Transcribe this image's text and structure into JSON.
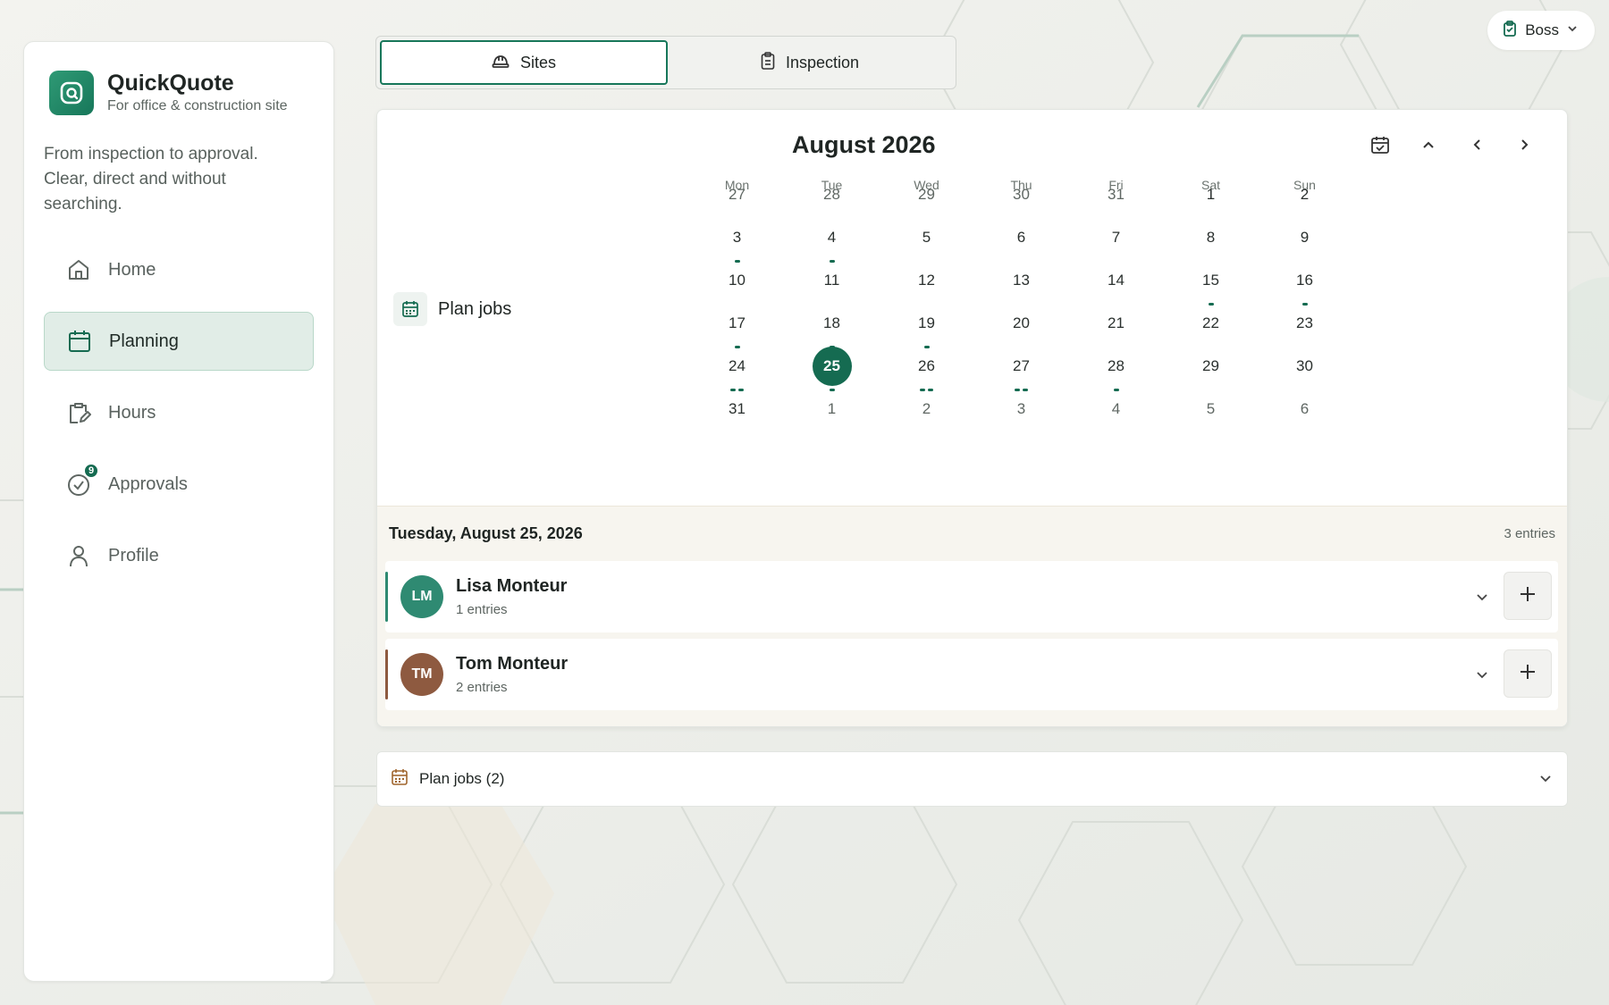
{
  "app": {
    "name": "QuickQuote",
    "subtitle": "For office & construction site",
    "tagline": "From inspection to approval. Clear, direct and without searching.",
    "accent": "#156b51"
  },
  "nav": [
    {
      "label": "Home",
      "icon": "home-icon",
      "active": false
    },
    {
      "label": "Planning",
      "icon": "calendar-icon",
      "active": true
    },
    {
      "label": "Hours",
      "icon": "clipboard-edit-icon",
      "active": false
    },
    {
      "label": "Approvals",
      "icon": "check-circle-icon",
      "active": false,
      "badge": "9"
    },
    {
      "label": "Profile",
      "icon": "user-icon",
      "active": false
    }
  ],
  "user": {
    "label": "Boss"
  },
  "tabs": [
    {
      "label": "Sites",
      "icon": "hard-hat-icon",
      "active": true
    },
    {
      "label": "Inspection",
      "icon": "clipboard-icon",
      "active": false
    }
  ],
  "calendar": {
    "plan_label": "Plan jobs",
    "month_title": "August 2026",
    "weekdays": [
      "Mon",
      "Tue",
      "Wed",
      "Thu",
      "Fri",
      "Sat",
      "Sun"
    ],
    "weeks": [
      [
        {
          "d": "27",
          "m": true
        },
        {
          "d": "28",
          "m": true
        },
        {
          "d": "29",
          "m": true
        },
        {
          "d": "30",
          "m": true
        },
        {
          "d": "31",
          "m": true
        },
        {
          "d": "1"
        },
        {
          "d": "2"
        }
      ],
      [
        {
          "d": "3",
          "dots": 1
        },
        {
          "d": "4",
          "dots": 1
        },
        {
          "d": "5"
        },
        {
          "d": "6"
        },
        {
          "d": "7"
        },
        {
          "d": "8"
        },
        {
          "d": "9"
        }
      ],
      [
        {
          "d": "10"
        },
        {
          "d": "11"
        },
        {
          "d": "12"
        },
        {
          "d": "13"
        },
        {
          "d": "14"
        },
        {
          "d": "15",
          "dots": 1
        },
        {
          "d": "16",
          "dots": 1
        }
      ],
      [
        {
          "d": "17",
          "dots": 1
        },
        {
          "d": "18",
          "dots": 1
        },
        {
          "d": "19",
          "dots": 1
        },
        {
          "d": "20"
        },
        {
          "d": "21"
        },
        {
          "d": "22"
        },
        {
          "d": "23"
        }
      ],
      [
        {
          "d": "24",
          "dots": 2
        },
        {
          "d": "25",
          "today": true,
          "dots": 1
        },
        {
          "d": "26",
          "dots": 2
        },
        {
          "d": "27",
          "dots": 2
        },
        {
          "d": "28",
          "dots": 1
        },
        {
          "d": "29"
        },
        {
          "d": "30"
        }
      ],
      [
        {
          "d": "31"
        },
        {
          "d": "1",
          "m": true
        },
        {
          "d": "2",
          "m": true
        },
        {
          "d": "3",
          "m": true
        },
        {
          "d": "4",
          "m": true
        },
        {
          "d": "5",
          "m": true
        },
        {
          "d": "6",
          "m": true
        }
      ]
    ]
  },
  "day": {
    "date_label": "Tuesday, August 25, 2026",
    "count_label": "3 entries",
    "people": [
      {
        "initials": "LM",
        "name": "Lisa Monteur",
        "entries": "1 entries",
        "color": "#2f8a72"
      },
      {
        "initials": "TM",
        "name": "Tom Monteur",
        "entries": "2 entries",
        "color": "#8e5a40"
      }
    ]
  },
  "collapse": {
    "label": "Plan jobs (2)"
  }
}
